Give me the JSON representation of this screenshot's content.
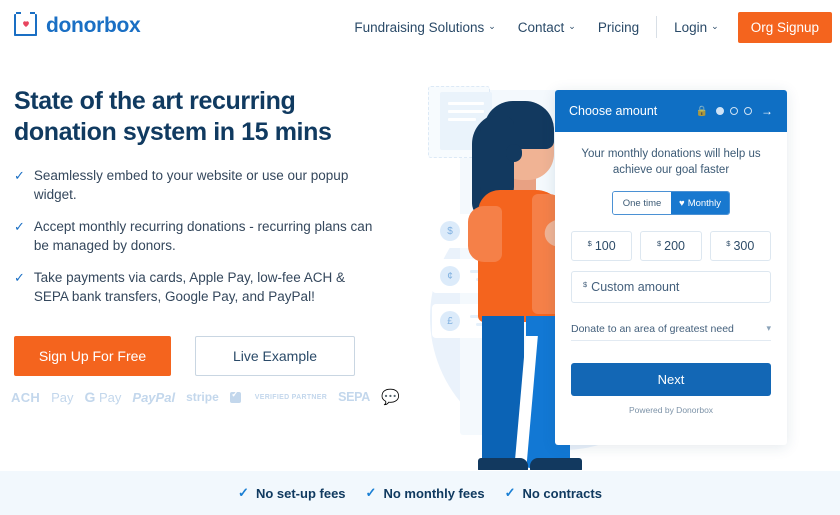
{
  "header": {
    "logo_text": "donorbox",
    "logo_icon": "donorbox-heart-box-icon",
    "nav": [
      {
        "label": "Fundraising Solutions",
        "has_caret": true
      },
      {
        "label": "Contact",
        "has_caret": true
      },
      {
        "label": "Pricing",
        "has_caret": false
      },
      {
        "label": "Login",
        "has_caret": true
      }
    ],
    "cta_label": "Org Signup",
    "cta_color": "#f4641e"
  },
  "hero": {
    "headline_line1": "State of the art recurring",
    "headline_line2": "donation system in 15 mins",
    "headline_color": "#103a60",
    "bullets": [
      "Seamlessly embed to your website or use our popup widget.",
      "Accept monthly recurring donations - recurring plans can be managed by donors.",
      "Take payments via cards, Apple Pay, low-fee ACH & SEPA bank transfers, Google Pay, and PayPal!"
    ],
    "primary_cta": "Sign Up For Free",
    "secondary_cta": "Live Example",
    "payment_logos": [
      "ACH",
      "Pay",
      "Pay",
      "PayPal",
      "stripe",
      "VERIFIED PARTNER",
      "SEPA",
      "chat-support-icon"
    ]
  },
  "widget": {
    "header_title": "Choose amount",
    "header_color": "#0f6fc4",
    "lock_icon": "lock-icon",
    "arrow_icon": "arrow-right-icon",
    "steps_total": 4,
    "steps_active": 1,
    "message": "Your monthly donations will help us achieve our goal faster",
    "toggle": {
      "one_time": "One time",
      "monthly": "Monthly",
      "monthly_icon": "heart-icon",
      "selected": "Monthly"
    },
    "currency_symbol": "$",
    "amounts": [
      "100",
      "200",
      "300"
    ],
    "custom_placeholder": "Custom amount",
    "designation": "Donate to an area of greatest need",
    "next_label": "Next",
    "powered_by": "Powered by Donorbox"
  },
  "illustration": {
    "money_cards": [
      "$",
      "¢",
      "£"
    ]
  },
  "bottom_bar": {
    "items": [
      "No set-up fees",
      "No monthly fees",
      "No contracts"
    ],
    "background": "#f2f8fd",
    "text_color": "#103a60"
  }
}
